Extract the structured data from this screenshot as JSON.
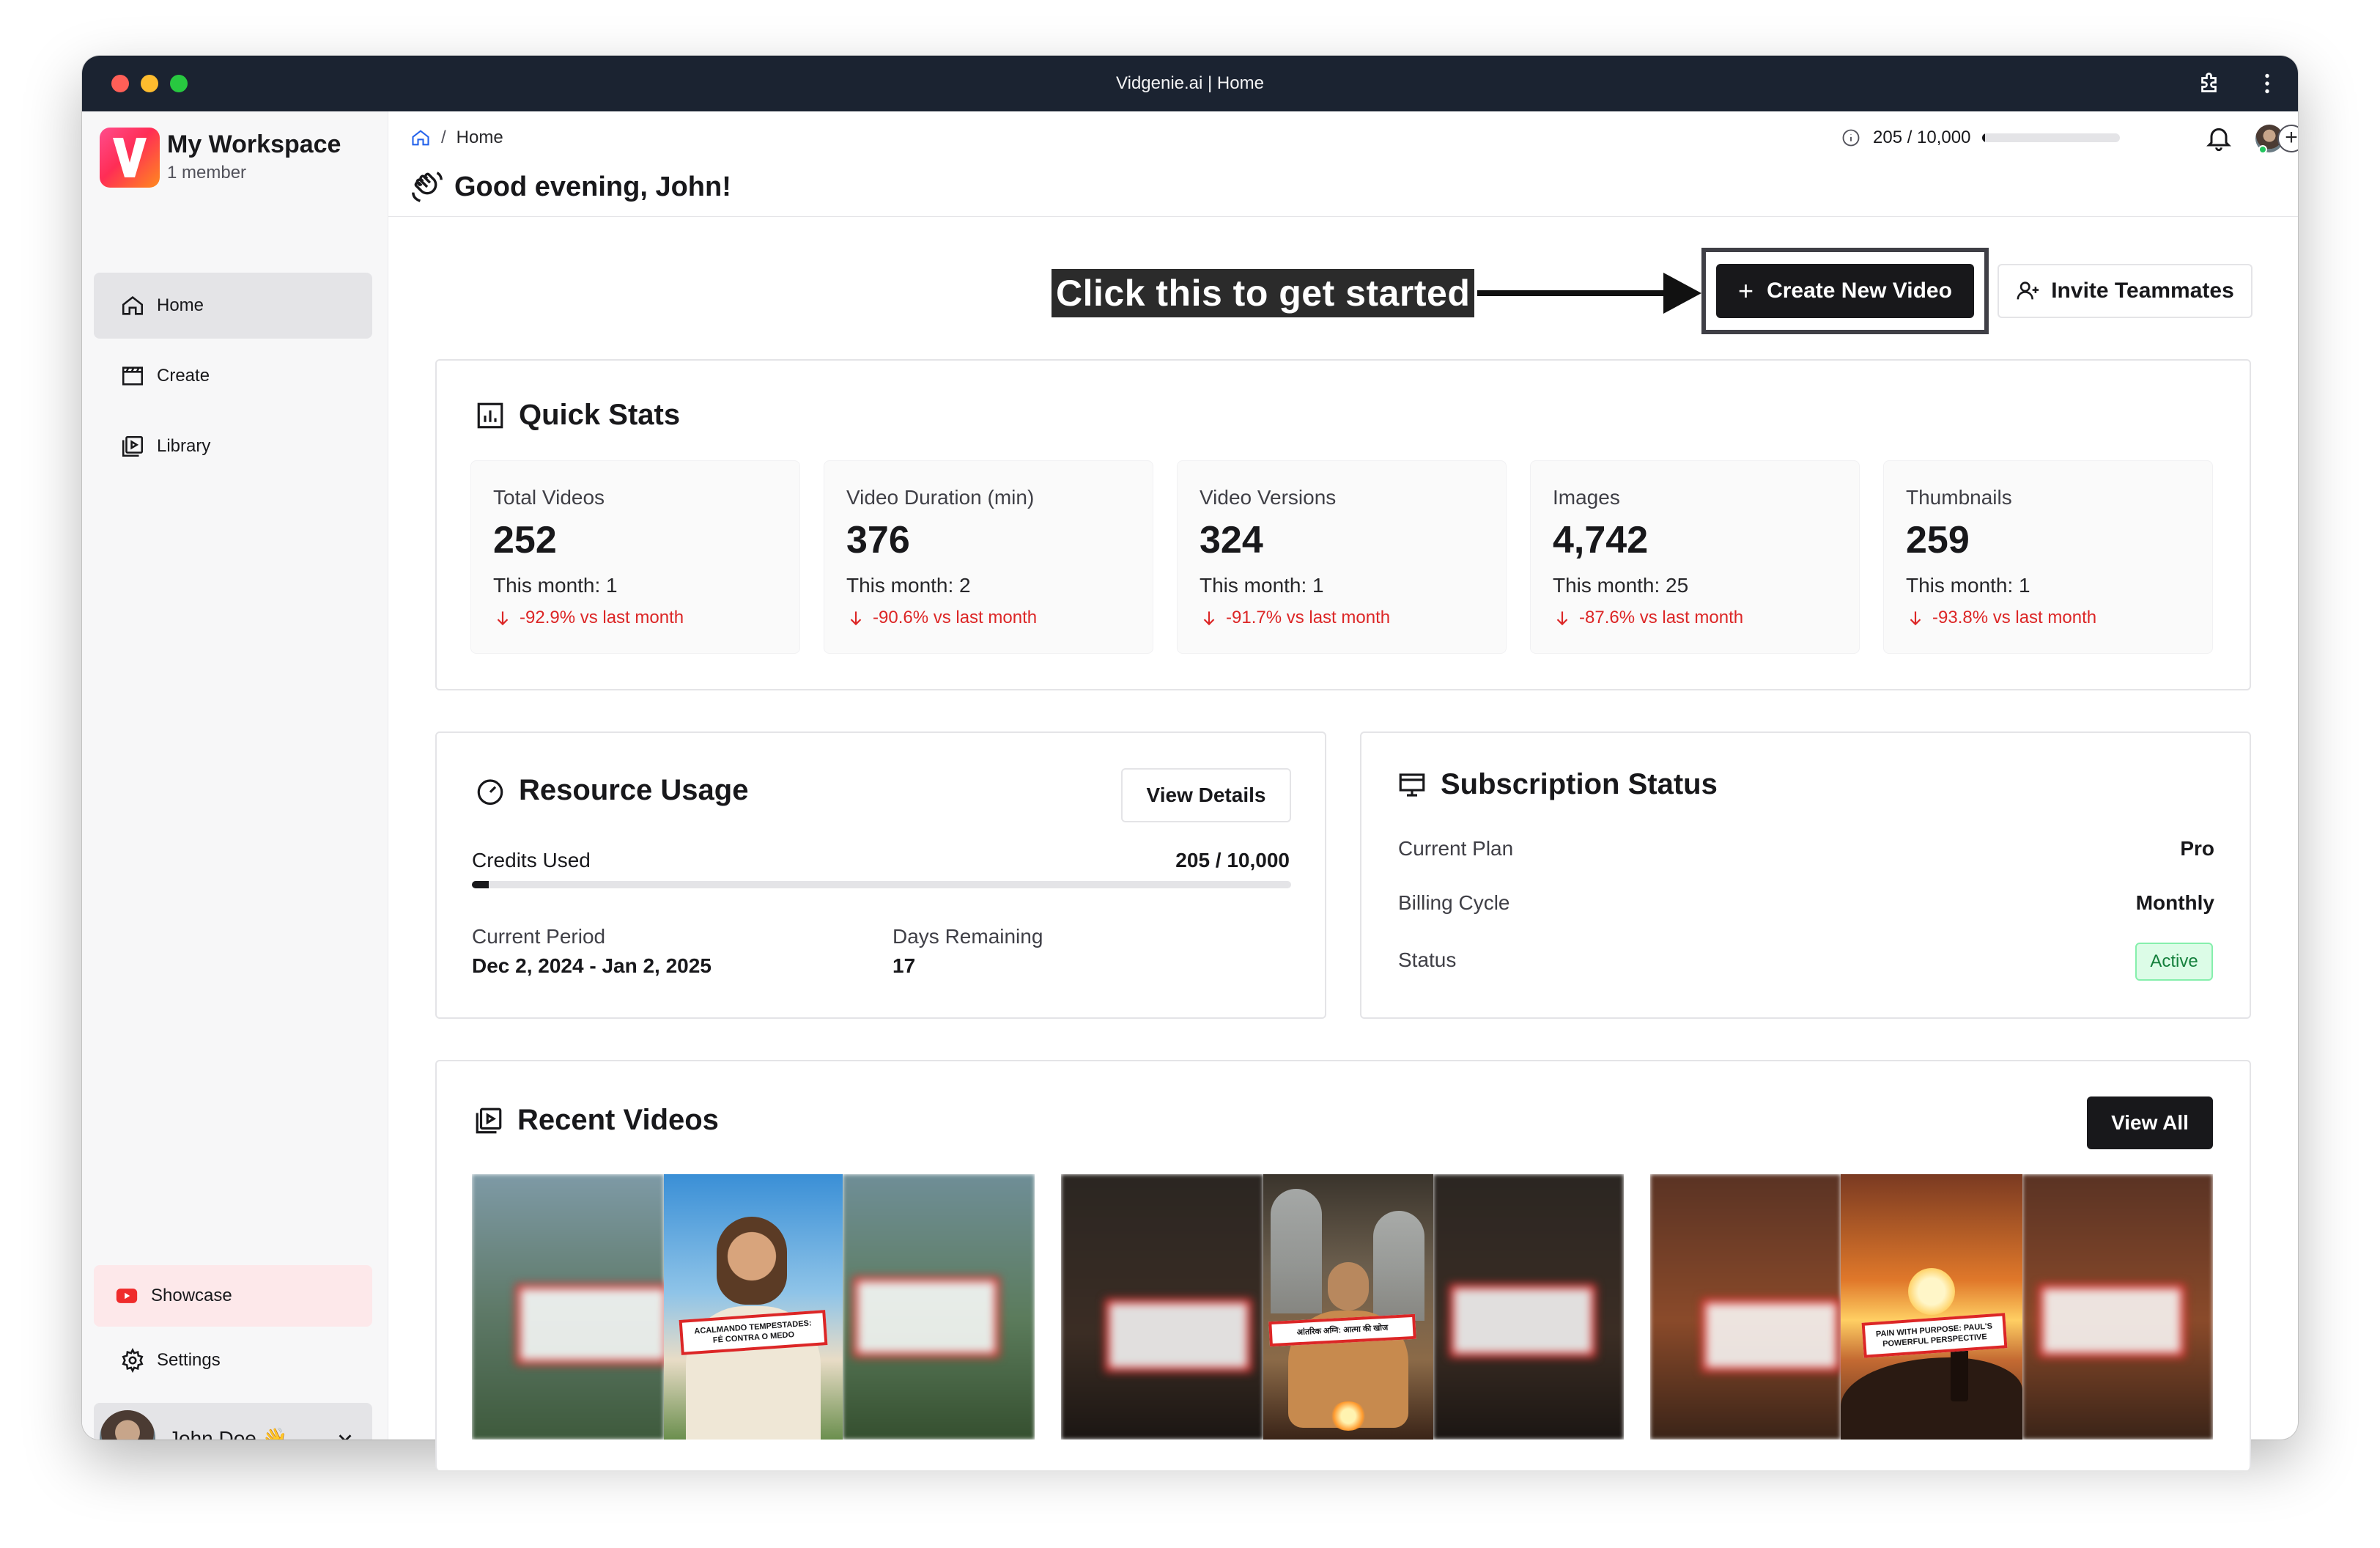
{
  "window": {
    "title": "Vidgenie.ai | Home"
  },
  "workspace": {
    "name": "My Workspace",
    "members": "1 member"
  },
  "sidebar": {
    "items": [
      {
        "label": "Home",
        "icon": "home-icon",
        "active": true
      },
      {
        "label": "Create",
        "icon": "clapperboard-icon",
        "active": false
      },
      {
        "label": "Library",
        "icon": "video-library-icon",
        "active": false
      }
    ],
    "showcase": {
      "label": "Showcase",
      "icon": "youtube-icon"
    },
    "settings": {
      "label": "Settings",
      "icon": "gear-icon"
    },
    "user": {
      "name": "John Doe 👋"
    }
  },
  "header": {
    "breadcrumb_sep": "/",
    "breadcrumb_page": "Home",
    "greeting": "Good evening, John!",
    "credits_text": "205 / 10,000",
    "credits_fraction": 0.0205
  },
  "cta": {
    "callout": "Click this to get started",
    "create_label": "Create New Video",
    "invite_label": "Invite Teammates"
  },
  "quick_stats": {
    "title": "Quick Stats",
    "stats": [
      {
        "label": "Total Videos",
        "value": "252",
        "month": "This month: 1",
        "delta": "-92.9% vs last month"
      },
      {
        "label": "Video Duration (min)",
        "value": "376",
        "month": "This month: 2",
        "delta": "-90.6% vs last month"
      },
      {
        "label": "Video Versions",
        "value": "324",
        "month": "This month: 1",
        "delta": "-91.7% vs last month"
      },
      {
        "label": "Images",
        "value": "4,742",
        "month": "This month: 25",
        "delta": "-87.6% vs last month"
      },
      {
        "label": "Thumbnails",
        "value": "259",
        "month": "This month: 1",
        "delta": "-93.8% vs last month"
      }
    ]
  },
  "resource_usage": {
    "title": "Resource Usage",
    "details_label": "View Details",
    "credits_label": "Credits Used",
    "credits_value": "205 / 10,000",
    "credits_fraction": 0.0205,
    "period_label": "Current Period",
    "period_value": "Dec 2, 2024 - Jan 2, 2025",
    "days_label": "Days Remaining",
    "days_value": "17"
  },
  "subscription": {
    "title": "Subscription Status",
    "plan_label": "Current Plan",
    "plan_value": "Pro",
    "billing_label": "Billing Cycle",
    "billing_value": "Monthly",
    "status_label": "Status",
    "status_value": "Active"
  },
  "recent_videos": {
    "title": "Recent Videos",
    "view_all_label": "View All",
    "videos": [
      {
        "caption": "ACALMANDO TEMPESTADES: FÉ CONTRA O MEDO"
      },
      {
        "caption": "आंतरिक अग्नि: आत्मा की खोज"
      },
      {
        "caption": "PAIN WITH PURPOSE: PAUL'S POWERFUL PERSPECTIVE"
      }
    ]
  },
  "colors": {
    "accent": "#18181b",
    "danger": "#dc2626",
    "success": "#15803d",
    "titlebar": "#1b2331"
  }
}
